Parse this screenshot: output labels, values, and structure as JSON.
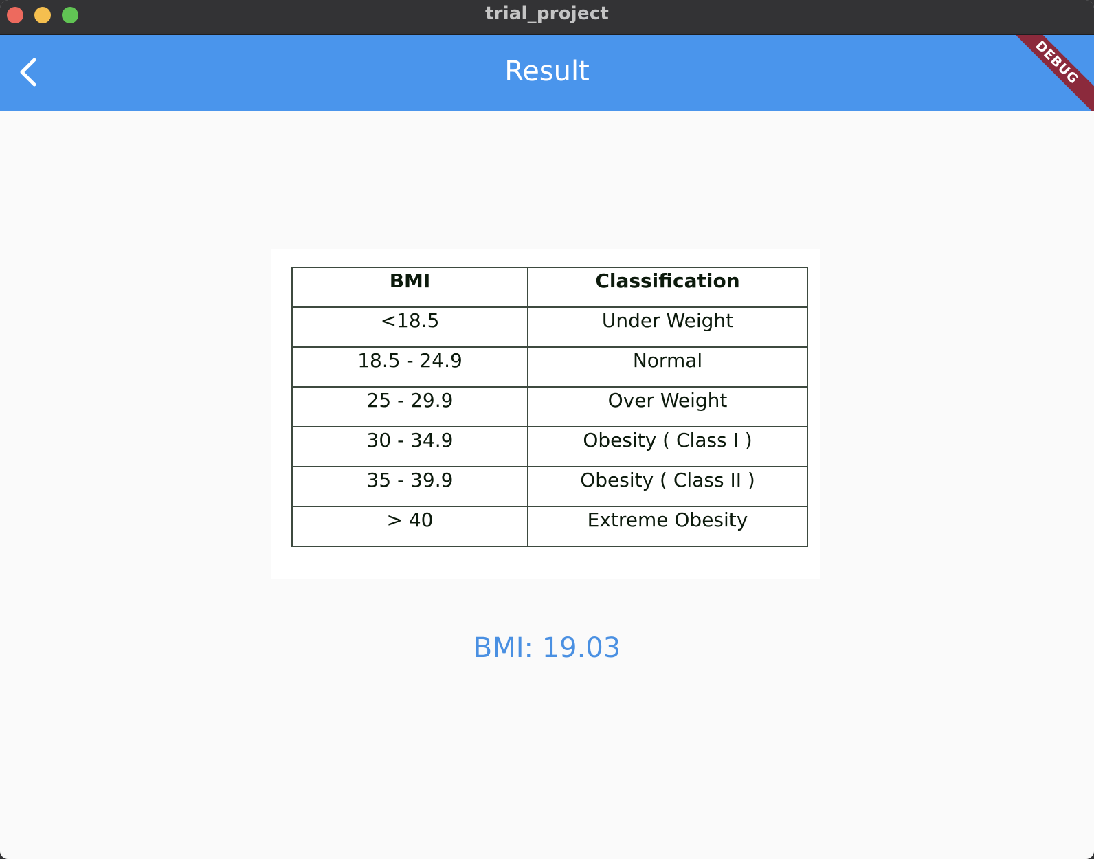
{
  "window": {
    "title": "trial_project"
  },
  "appbar": {
    "title": "Result",
    "debug_banner": "DEBUG"
  },
  "bmi_table": {
    "headers": [
      "BMI",
      "Classification"
    ],
    "rows": [
      [
        "<18.5",
        "Under Weight"
      ],
      [
        "18.5 - 24.9",
        "Normal"
      ],
      [
        "25 - 29.9",
        "Over Weight"
      ],
      [
        "30 - 34.9",
        "Obesity ( Class I )"
      ],
      [
        "35 - 39.9",
        "Obesity ( Class II )"
      ],
      [
        "> 40",
        "Extreme Obesity"
      ]
    ]
  },
  "result": {
    "text": "BMI: 19.03"
  },
  "colors": {
    "appbar": "#4a95ec",
    "result_text": "#4a90e2",
    "debug_banner": "#8b2a3c"
  },
  "icons": {
    "back": "chevron-left-icon"
  }
}
